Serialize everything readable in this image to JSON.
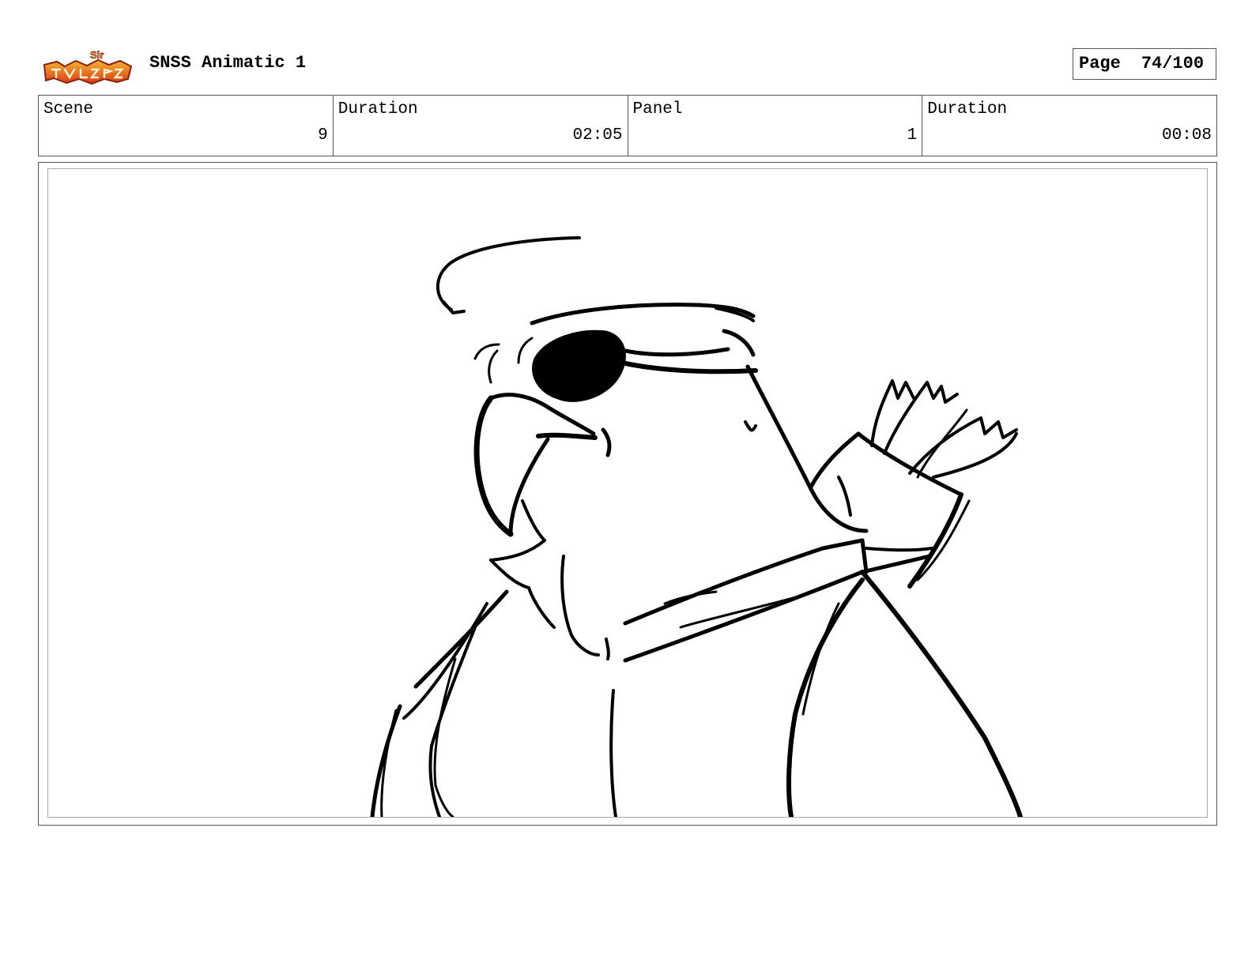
{
  "header": {
    "logo_text": "Sir Fool-So-Good",
    "title": "SNSS Animatic 1",
    "page_label": "Page",
    "page_value": "74/100"
  },
  "info": {
    "scene_label": "Scene",
    "scene_value": "9",
    "scene_duration_label": "Duration",
    "scene_duration_value": "02:05",
    "panel_label": "Panel",
    "panel_value": "1",
    "panel_duration_label": "Duration",
    "panel_duration_value": "00:08"
  },
  "panel": {
    "drawing": "bird-character-sketch"
  },
  "colors": {
    "logo_orange": "#e8531c",
    "logo_yellow": "#f7b731",
    "ink": "#000000"
  }
}
